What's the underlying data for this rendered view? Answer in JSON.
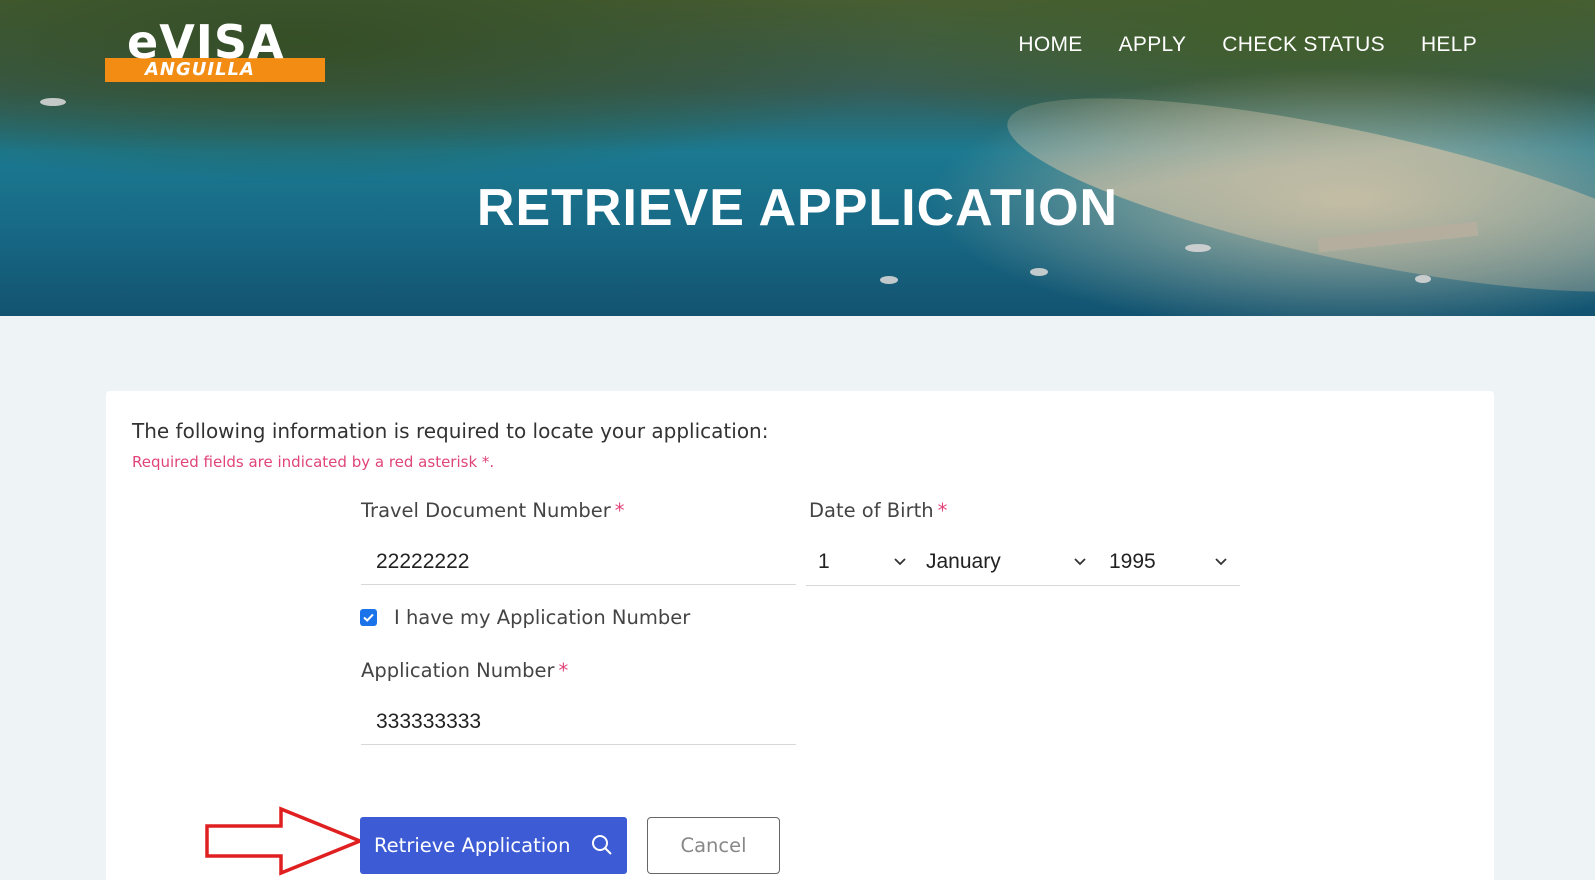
{
  "logo": {
    "main": "eVISA",
    "sub": "ANGUILLA"
  },
  "nav": [
    "HOME",
    "APPLY",
    "CHECK STATUS",
    "HELP"
  ],
  "hero_title": "RETRIEVE APPLICATION",
  "form": {
    "intro": "The following information is required to locate your application:",
    "required_note": "Required fields are indicated by a red asterisk *.",
    "travel_doc_label": "Travel Document Number",
    "travel_doc_value": "22222222",
    "dob_label": "Date of Birth",
    "dob_day": "1",
    "dob_month": "January",
    "dob_year": "1995",
    "checkbox_label": "I have my Application Number",
    "checkbox_checked": true,
    "app_number_label": "Application Number",
    "app_number_value": "333333333",
    "asterisk": "*"
  },
  "buttons": {
    "retrieve": "Retrieve Application",
    "cancel": "Cancel"
  },
  "colors": {
    "primary": "#3c5bd5",
    "required": "#e0447a",
    "logo_orange": "#f28c12",
    "arrow": "#e02020"
  }
}
